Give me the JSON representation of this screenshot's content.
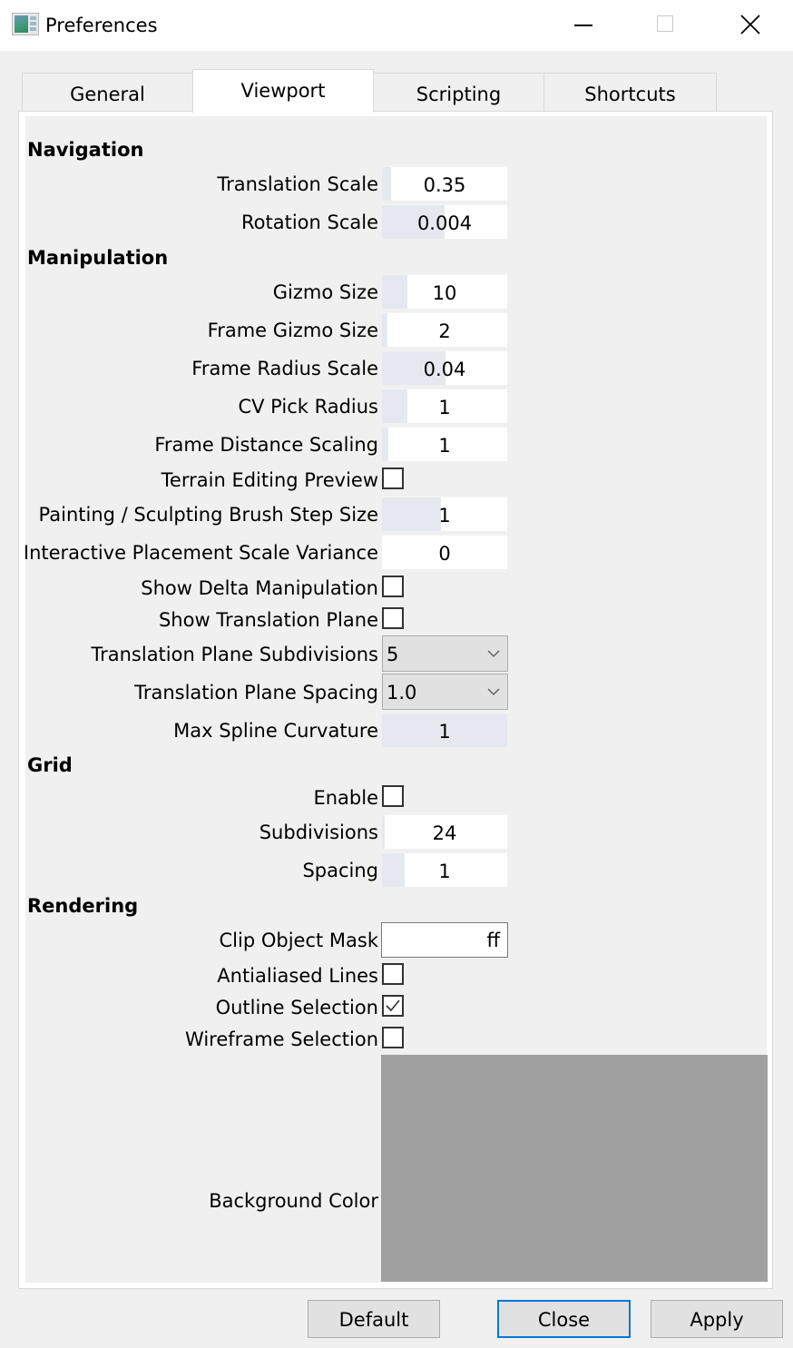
{
  "window": {
    "title": "Preferences",
    "controls": {
      "minimize": "minimize",
      "maximize": "maximize",
      "close": "close"
    }
  },
  "tabs": [
    {
      "label": "General",
      "active": false
    },
    {
      "label": "Viewport",
      "active": true
    },
    {
      "label": "Scripting",
      "active": false
    },
    {
      "label": "Shortcuts",
      "active": false
    }
  ],
  "sections": {
    "navigation": "Navigation",
    "manipulation": "Manipulation",
    "grid": "Grid",
    "rendering": "Rendering"
  },
  "fields": {
    "translation_scale": {
      "label": "Translation Scale",
      "value": "0.35",
      "slider_fraction": 0.07
    },
    "rotation_scale": {
      "label": "Rotation Scale",
      "value": "0.004",
      "slider_fraction": 0.5
    },
    "gizmo_size": {
      "label": "Gizmo Size",
      "value": "10",
      "slider_fraction": 0.2
    },
    "frame_gizmo_size": {
      "label": "Frame Gizmo Size",
      "value": "2",
      "slider_fraction": 0.04
    },
    "frame_radius_scale": {
      "label": "Frame Radius Scale",
      "value": "0.04",
      "slider_fraction": 0.51
    },
    "cv_pick_radius": {
      "label": "CV Pick Radius",
      "value": "1",
      "slider_fraction": 0.2
    },
    "frame_distance_scaling": {
      "label": "Frame Distance Scaling",
      "value": "1",
      "slider_fraction": 0.05
    },
    "terrain_editing_preview": {
      "label": "Terrain Editing Preview",
      "checked": false
    },
    "brush_step_size": {
      "label": "Painting / Sculpting Brush Step Size",
      "value": "1",
      "slider_fraction": 0.47
    },
    "placement_scale_variance": {
      "label": "Interactive Placement Scale Variance",
      "value": "0",
      "slider_fraction": 0.0
    },
    "show_delta_manipulation": {
      "label": "Show Delta Manipulation",
      "checked": false
    },
    "show_translation_plane": {
      "label": "Show Translation Plane",
      "checked": false
    },
    "translation_plane_subdivisions": {
      "label": "Translation Plane Subdivisions",
      "value": "5"
    },
    "translation_plane_spacing": {
      "label": "Translation Plane Spacing",
      "value": "1.0"
    },
    "max_spline_curvature": {
      "label": "Max Spline Curvature",
      "value": "1",
      "slider_fraction": 1.0
    },
    "grid_enable": {
      "label": "Enable",
      "checked": false
    },
    "grid_subdivisions": {
      "label": "Subdivisions",
      "value": "24",
      "slider_fraction": 0.02
    },
    "grid_spacing": {
      "label": "Spacing",
      "value": "1",
      "slider_fraction": 0.18
    },
    "clip_object_mask": {
      "label": "Clip Object Mask",
      "value": "ff"
    },
    "antialiased_lines": {
      "label": "Antialiased Lines",
      "checked": false
    },
    "outline_selection": {
      "label": "Outline Selection",
      "checked": true
    },
    "wireframe_selection": {
      "label": "Wireframe Selection",
      "checked": false
    },
    "background_color": {
      "label": "Background Color",
      "color": "#a0a0a0"
    }
  },
  "buttons": {
    "default": "Default",
    "close": "Close",
    "apply": "Apply"
  },
  "colors": {
    "focus_accent": "#0078d7",
    "slider_fill": "#e5e9ef"
  }
}
